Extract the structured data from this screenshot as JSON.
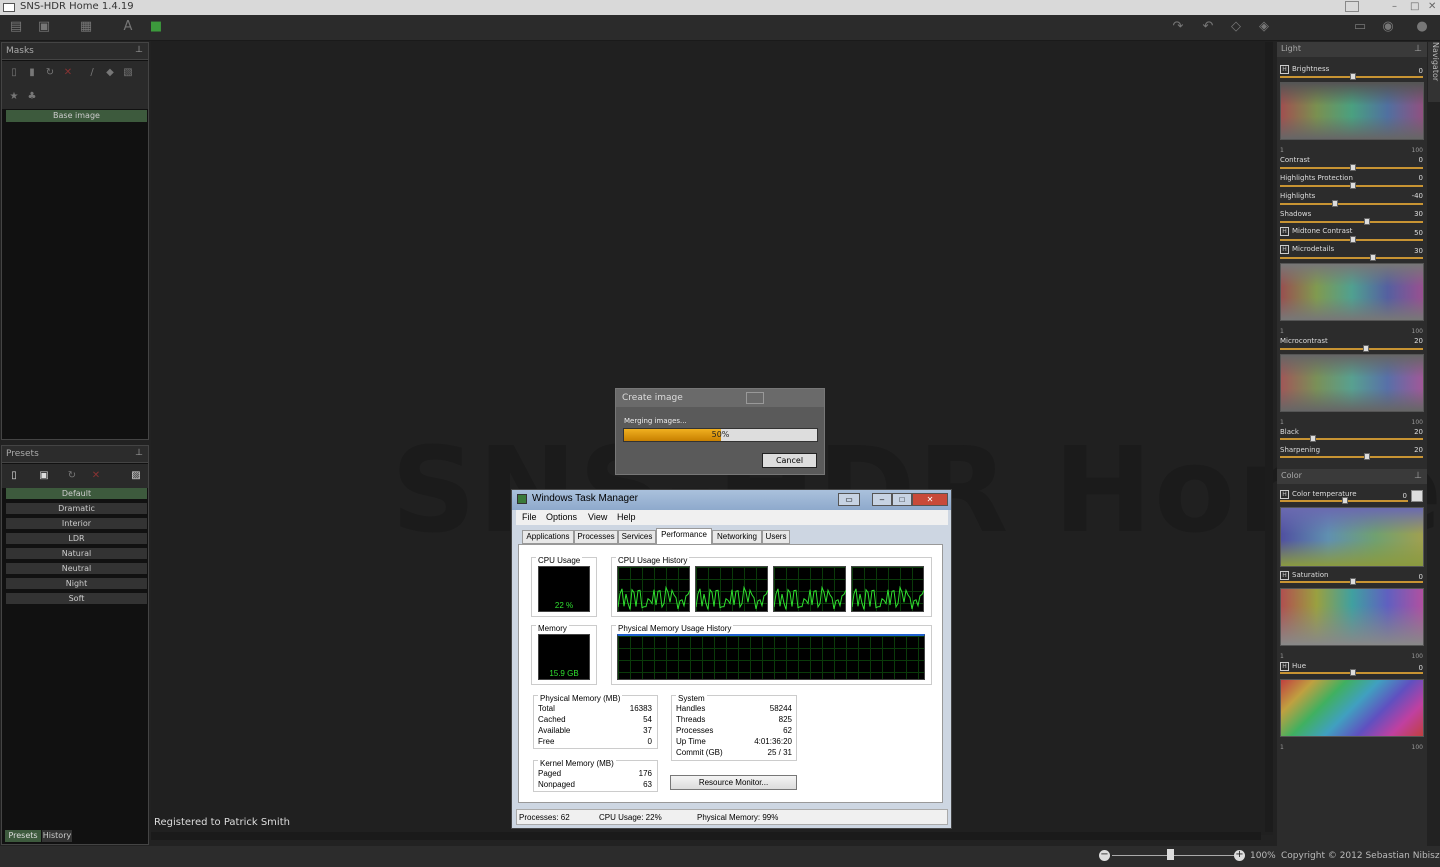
{
  "app": {
    "title": "SNS-HDR Home 1.4.19"
  },
  "masks": {
    "title": "Masks",
    "base": "Base image"
  },
  "presets": {
    "title": "Presets",
    "items": [
      "Default",
      "Dramatic",
      "Interior",
      "LDR",
      "Natural",
      "Neutral",
      "Night",
      "Soft"
    ],
    "tab_presets": "Presets",
    "tab_history": "History"
  },
  "canvas": {
    "watermark": "SNS-HDR Home",
    "registered": "Registered to Patrick Smith"
  },
  "dialog": {
    "title": "Create image",
    "status": "Merging images...",
    "progress_text": "50%",
    "progress": 0.5,
    "cancel": "Cancel"
  },
  "light": {
    "title": "Light",
    "brightness": "Brightness",
    "brightness_val": "0",
    "contrast": "Contrast",
    "contrast_val": "0",
    "hl_prot": "Highlights Protection",
    "hl_prot_val": "0",
    "highlights": "Highlights",
    "highlights_val": "-40",
    "shadows": "Shadows",
    "shadows_val": "30",
    "midtone": "Midtone Contrast",
    "midtone_val": "50",
    "microdetails": "Microdetails",
    "microdetails_val": "30",
    "microcontrast": "Microcontrast",
    "microcontrast_val": "20",
    "black": "Black",
    "black_val": "20",
    "sharpening": "Sharpening",
    "sharpening_val": "20",
    "tick1": "1",
    "tick100": "100"
  },
  "color": {
    "title": "Color",
    "temp": "Color temperature",
    "temp_val": "0",
    "saturation": "Saturation",
    "saturation_val": "0",
    "hue": "Hue",
    "hue_val": "0"
  },
  "navigator": "Navigator",
  "taskmgr": {
    "title": "Windows Task Manager",
    "menu": [
      "File",
      "Options",
      "View",
      "Help"
    ],
    "tabs": [
      "Applications",
      "Processes",
      "Services",
      "Performance",
      "Networking",
      "Users"
    ],
    "cpu_usage": "CPU Usage",
    "cpu_value": "22 %",
    "cpu_history": "CPU Usage History",
    "memory": "Memory",
    "memory_value": "15.9 GB",
    "pmem_history": "Physical Memory Usage History",
    "phys_title": "Physical Memory (MB)",
    "phys": [
      [
        "Total",
        "16383"
      ],
      [
        "Cached",
        "54"
      ],
      [
        "Available",
        "37"
      ],
      [
        "Free",
        "0"
      ]
    ],
    "kern_title": "Kernel Memory (MB)",
    "kern": [
      [
        "Paged",
        "176"
      ],
      [
        "Nonpaged",
        "63"
      ]
    ],
    "sys_title": "System",
    "sys": [
      [
        "Handles",
        "58244"
      ],
      [
        "Threads",
        "825"
      ],
      [
        "Processes",
        "62"
      ],
      [
        "Up Time",
        "4:01:36:20"
      ],
      [
        "Commit (GB)",
        "25 / 31"
      ]
    ],
    "resmon": "Resource Monitor...",
    "sb_proc": "Processes: 62",
    "sb_cpu": "CPU Usage: 22%",
    "sb_mem": "Physical Memory: 99%"
  },
  "status": {
    "zoom": "100%",
    "copyright": "Copyright © 2012 Sebastian Nibisz"
  }
}
